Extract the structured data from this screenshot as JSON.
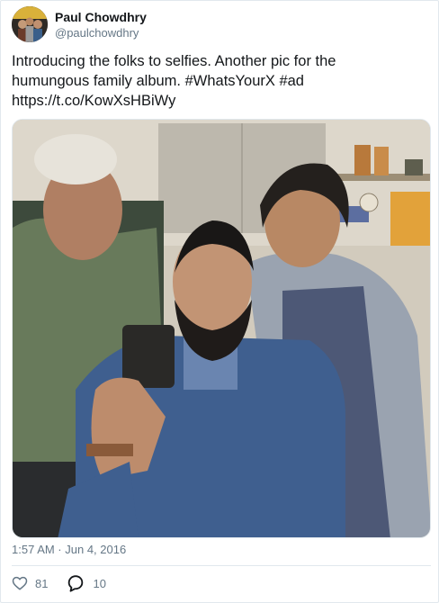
{
  "tweet": {
    "author": {
      "display_name": "Paul Chowdhry",
      "handle": "@paulchowdhry"
    },
    "text": "Introducing the folks to selfies. Another pic for the\nhumungous family album. #WhatsYourX #ad\nhttps://t.co/KowXsHBiWy",
    "timestamp": "1:57 AM · Jun 4, 2016",
    "likes": "81",
    "replies": "10",
    "icons": {
      "like": "heart-icon",
      "reply": "comment-bubble-icon"
    },
    "colors": {
      "text": "#14171a",
      "muted": "#657786",
      "border": "#e1e8ed"
    }
  }
}
